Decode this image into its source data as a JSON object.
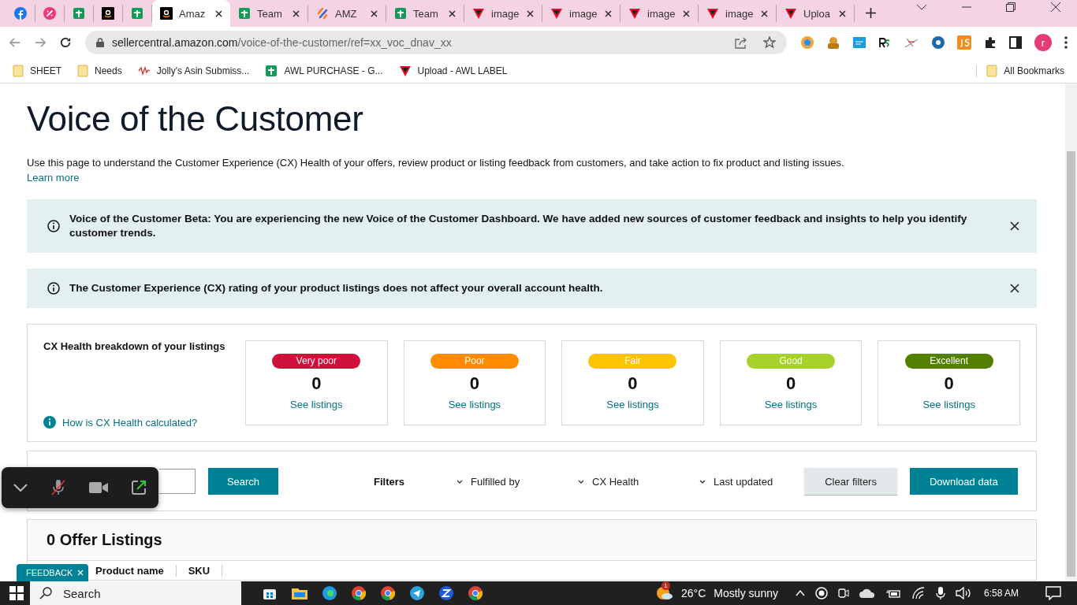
{
  "tabs": [
    {
      "kind": "facebook",
      "selected": false
    },
    {
      "kind": "percent",
      "selected": false
    },
    {
      "kind": "sheets",
      "selected": false
    },
    {
      "kind": "amazon",
      "selected": false
    },
    {
      "kind": "sheets",
      "selected": false
    },
    {
      "kind": "amazon",
      "title": "Amaz",
      "selected": true
    },
    {
      "kind": "sheets",
      "title": "Team",
      "selected": false
    },
    {
      "kind": "amz",
      "title": "AMZ",
      "selected": false
    },
    {
      "kind": "sheets",
      "title": "Team",
      "selected": false
    },
    {
      "kind": "triangle",
      "title": "image",
      "selected": false
    },
    {
      "kind": "triangle",
      "title": "image",
      "selected": false
    },
    {
      "kind": "triangle",
      "title": "image",
      "selected": false
    },
    {
      "kind": "triangle",
      "title": "image",
      "selected": false
    },
    {
      "kind": "triangle",
      "title": "Uploa",
      "selected": false
    }
  ],
  "address": {
    "host": "sellercentral.amazon.com",
    "path": "/voice-of-the-customer/ref=xx_voc_dnav_xx"
  },
  "profile": "r",
  "bookmarks": [
    {
      "kind": "folder",
      "label": "SHEET"
    },
    {
      "kind": "folder",
      "label": "Needs"
    },
    {
      "kind": "wave",
      "label": "Jolly's Asin Submiss..."
    },
    {
      "kind": "sheets",
      "label": "AWL PURCHASE - G..."
    },
    {
      "kind": "triangle",
      "label": "Upload - AWL LABEL"
    }
  ],
  "all_bookmarks": "All Bookmarks",
  "page": {
    "title": "Voice of the Customer",
    "intro": "Use this page to understand the Customer Experience (CX) Health of your offers, review product or listing feedback from customers, and take action to fix product and listing issues.",
    "learn_more": "Learn more",
    "alerts": [
      "Voice of the Customer Beta: You are experiencing the new Voice of the Customer Dashboard. We have added new sources of customer feedback and insights to help you identify customer trends.",
      "The Customer Experience (CX) rating of your product listings does not affect your overall account health."
    ],
    "breakdown": {
      "title": "CX Health breakdown of your listings",
      "help_link": "How is CX Health calculated?",
      "cards": [
        {
          "label": "Very poor",
          "color": "#d0103a",
          "count": "0",
          "link": "See listings"
        },
        {
          "label": "Poor",
          "color": "#ff8c00",
          "count": "0",
          "link": "See listings"
        },
        {
          "label": "Fair",
          "color": "#ffc400",
          "count": "0",
          "link": "See listings"
        },
        {
          "label": "Good",
          "color": "#a6d22a",
          "count": "0",
          "link": "See listings"
        },
        {
          "label": "Excellent",
          "color": "#538000",
          "count": "0",
          "link": "See listings"
        }
      ]
    },
    "search_button": "Search",
    "filters_label": "Filters",
    "filters": [
      "Fulfilled by",
      "CX Health",
      "Last updated"
    ],
    "clear_button": "Clear filters",
    "download_button": "Download data",
    "listings_title": "0 Offer Listings",
    "columns": [
      "Product name",
      "SKU"
    ]
  },
  "feedback": "FEEDBACK",
  "taskbar": {
    "search": "Search",
    "weather_badge": "1",
    "temperature": "26°C",
    "weather": "Mostly sunny",
    "time": "6:58 AM"
  }
}
